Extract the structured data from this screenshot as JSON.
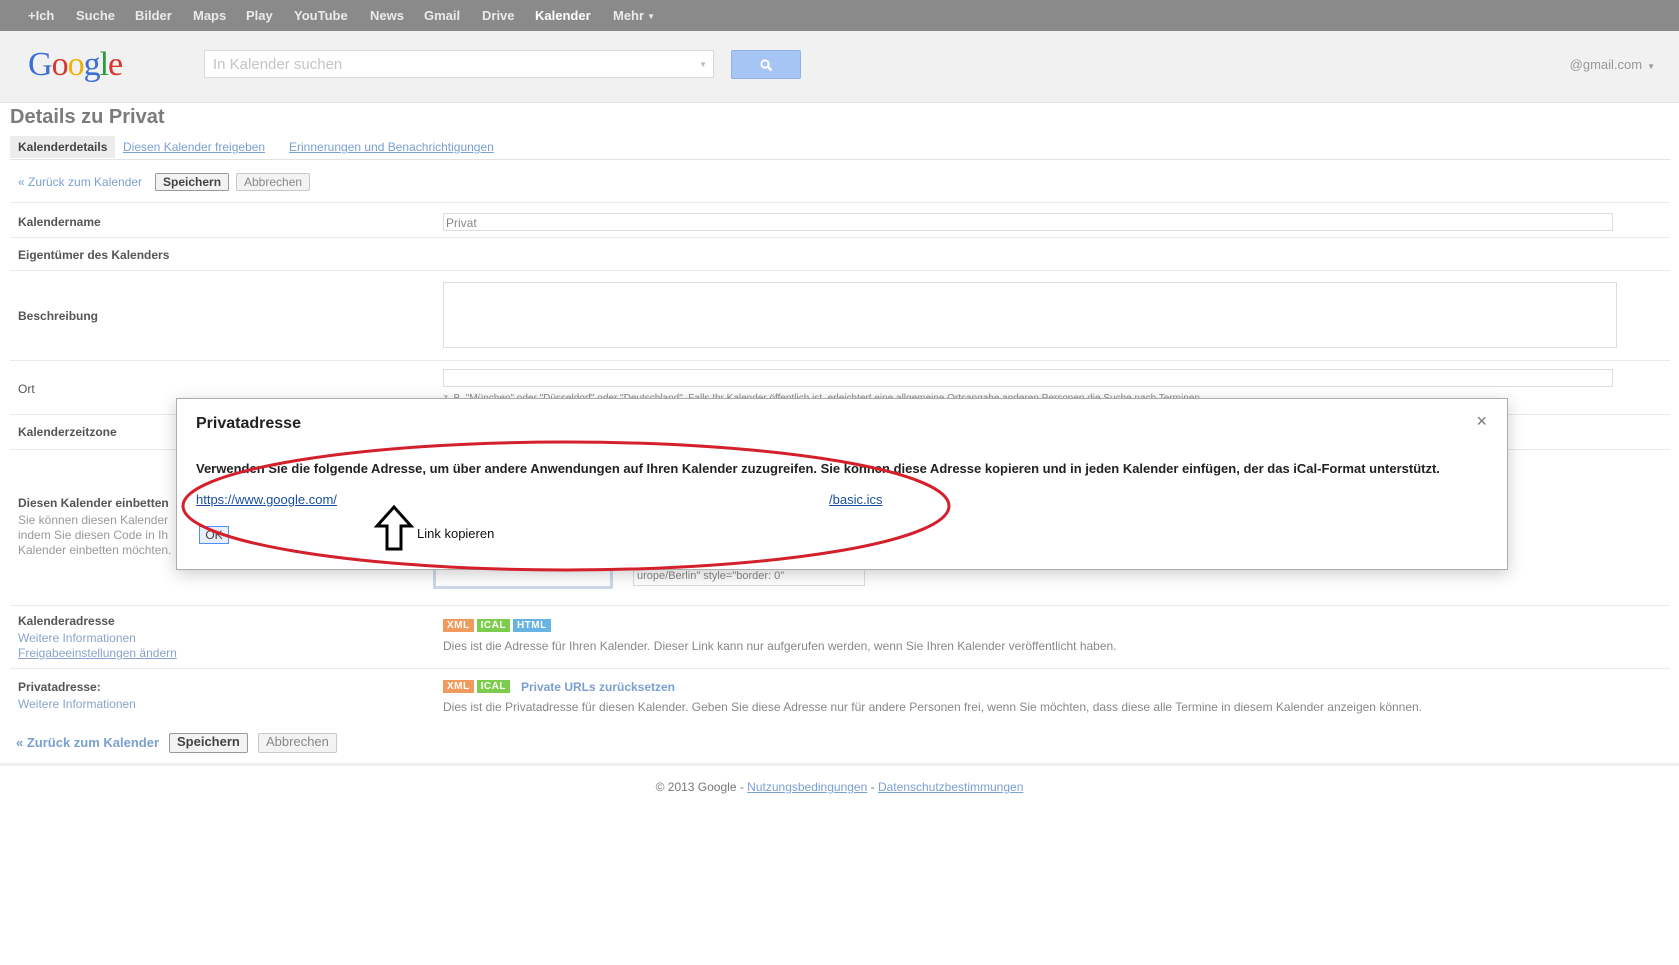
{
  "topbar": {
    "items": [
      "+Ich",
      "Suche",
      "Bilder",
      "Maps",
      "Play",
      "YouTube",
      "News",
      "Gmail",
      "Drive",
      "Kalender",
      "Mehr"
    ],
    "active": "Kalender"
  },
  "header": {
    "logo": "Google",
    "search_placeholder": "In Kalender suchen",
    "account": "@gmail.com"
  },
  "page": {
    "title": "Details zu Privat",
    "tabs": [
      "Kalenderdetails",
      "Diesen Kalender freigeben",
      "Erinnerungen und Benachrichtigungen"
    ],
    "back_link": "« Zurück zum Kalender",
    "save_label": "Speichern",
    "cancel_label": "Abbrechen"
  },
  "form": {
    "name_label": "Kalendername",
    "name_value": "Privat",
    "owner_label": "Eigentümer des Kalenders",
    "description_label": "Beschreibung",
    "location_label": "Ort",
    "location_hint": "z. B. \"München\" oder \"Düsseldorf\" oder \"Deutschland\". Falls Ihr Kalender öffentlich ist, erleichtert eine allgemeine Ortsangabe anderen Personen die Suche nach Terminen.",
    "timezone_label": "Kalenderzeitzone",
    "embed_label": "Diesen Kalender einbetten",
    "embed_desc_1": "Sie können diesen Kalender",
    "embed_desc_2": "indem Sie diesen Code in Ih",
    "embed_desc_3": "Kalender einbetten möchten.",
    "embed_code": "urope/Berlin\" style=\"border: 0\"",
    "address_label": "Kalenderadresse",
    "address_more": "Weitere Informationen",
    "address_sharing": "Freigabeeinstellungen ändern",
    "address_desc": "Dies ist die Adresse für Ihren Kalender. Dieser Link kann nur aufgerufen werden, wenn Sie Ihren Kalender veröffentlicht haben.",
    "private_label": "Privatadresse:",
    "private_more": "Weitere Informationen",
    "private_reset": "Private URLs zurücksetzen",
    "private_desc": "Dies ist die Privatadresse für diesen Kalender. Geben Sie diese Adresse nur für andere Personen frei, wenn Sie möchten, dass diese alle Termine in diesem Kalender anzeigen können.",
    "badge_xml": "XML",
    "badge_ical": "ICAL",
    "badge_html": "HTML"
  },
  "footer": {
    "copyright": "© 2013 Google -",
    "terms": "Nutzungsbedingungen",
    "sep": "-",
    "privacy": "Datenschutzbestimmungen"
  },
  "dialog": {
    "title": "Privatadresse",
    "text": "Verwenden Sie die folgende Adresse, um über andere Anwendungen auf Ihren Kalender zuzugreifen. Sie können diese Adresse kopieren und in jeden Kalender einfügen, der das iCal-Format unterstützt.",
    "url_start": "https://www.google.com/",
    "url_end": "/basic.ics",
    "ok_label": "OK",
    "annotation": "Link kopieren",
    "close_symbol": "×"
  },
  "colors": {
    "annotation_ellipse": "#d4202a",
    "link": "#7a9fd1"
  }
}
